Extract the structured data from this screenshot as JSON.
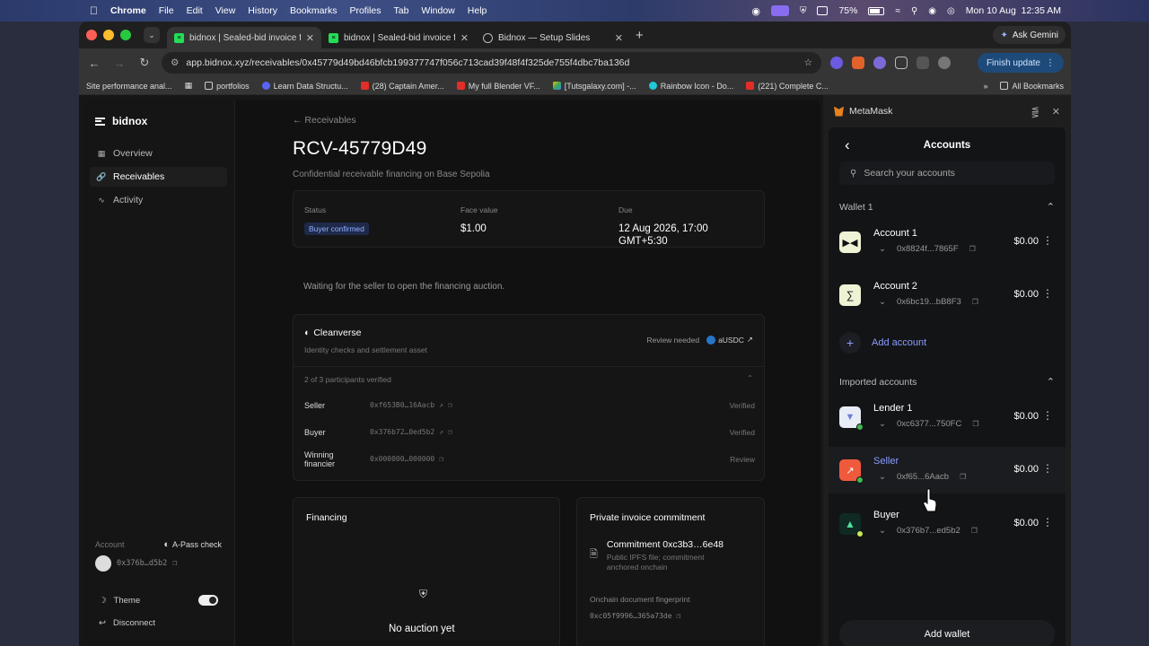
{
  "menubar": {
    "app": "Chrome",
    "menus": [
      "File",
      "Edit",
      "View",
      "History",
      "Bookmarks",
      "Profiles",
      "Tab",
      "Window",
      "Help"
    ],
    "battery": "75%",
    "clock": "Mon 10 Aug  12:35 AM"
  },
  "tabs": [
    {
      "title": "bidnox | Sealed-bid invoice fi"
    },
    {
      "title": "bidnox | Sealed-bid invoice fi"
    },
    {
      "title": "Bidnox — Setup Slides"
    }
  ],
  "ask_gemini": "Ask Gemini",
  "address_bar": {
    "url": "app.bidnox.xyz/receivables/0x45779d49bd46bfcb199377747f056c713cad39f48f4f325de755f4dbc7ba136d"
  },
  "finish_update": "Finish update",
  "bookmarks": [
    "Site performance anal...",
    "portfolios",
    "Learn Data Structu...",
    "(28) Captain Amer...",
    "My full Blender VF...",
    "[Tutsgalaxy.com] -...",
    "Rainbow Icon - Do...",
    "(221) Complete C..."
  ],
  "all_bookmarks": "All Bookmarks",
  "app": {
    "brand": "bidnox",
    "nav": [
      "Overview",
      "Receivables",
      "Activity"
    ],
    "footer": {
      "account_label": "Account",
      "apass": "A-Pass check",
      "address": "0x376b…d5b2",
      "theme": "Theme",
      "disconnect": "Disconnect"
    }
  },
  "receivable": {
    "back": "Receivables",
    "title": "RCV-45779D49",
    "subtitle": "Confidential receivable financing on Base Sepolia",
    "status_label": "Status",
    "status": "Buyer confirmed",
    "face_label": "Face value",
    "face": "$1.00",
    "due_label": "Due",
    "due_line1": "12 Aug 2026, 17:00",
    "due_line2": "GMT+5:30",
    "waiting": "Waiting for the seller to open the financing auction."
  },
  "cleanverse": {
    "title": "Cleanverse",
    "subtitle": "Identity checks and settlement asset",
    "review": "Review needed",
    "asset": "aUSDC",
    "count": "2 of 3 participants verified",
    "participants": [
      {
        "role": "Seller",
        "address": "0xf653B0…16Aacb",
        "status": "Verified"
      },
      {
        "role": "Buyer",
        "address": "0x376b72…0ed5b2",
        "status": "Verified"
      },
      {
        "role": "Winning financier",
        "address": "0x000000…000000",
        "status": "Review"
      }
    ]
  },
  "financing": {
    "title": "Financing",
    "empty": "No auction yet"
  },
  "commitment": {
    "title": "Private invoice commitment",
    "commit": "Commitment 0xc3b3…6e48",
    "desc_line1": "Public IPFS file; commitment",
    "desc_line2": "anchored onchain",
    "fp_label": "Onchain document fingerprint",
    "fp": "0xc05f9996…365a73de"
  },
  "metamask": {
    "header": "MetaMask",
    "title": "Accounts",
    "search_placeholder": "Search your accounts",
    "wallet_group": "Wallet 1",
    "imported_group": "Imported accounts",
    "add_account": "Add account",
    "add_wallet": "Add wallet",
    "wallet_accounts": [
      {
        "name": "Account 1",
        "address": "0x8824f...7865F",
        "balance": "$0.00"
      },
      {
        "name": "Account 2",
        "address": "0x6bc19...bB8F3",
        "balance": "$0.00"
      }
    ],
    "imported_accounts": [
      {
        "name": "Lender 1",
        "address": "0xc6377...750FC",
        "balance": "$0.00"
      },
      {
        "name": "Seller",
        "address": "0xf65...6Aacb",
        "balance": "$0.00"
      },
      {
        "name": "Buyer",
        "address": "0x376b7...ed5b2",
        "balance": "$0.00"
      }
    ],
    "colors": {
      "accent": "#8b9cff",
      "online": "#3fb950"
    }
  }
}
